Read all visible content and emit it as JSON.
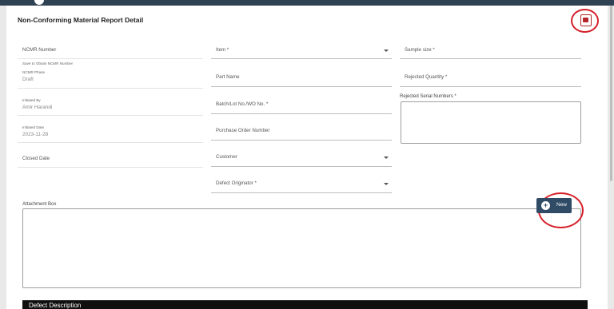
{
  "page": {
    "title": "Non-Conforming Material Report Detail"
  },
  "fields": {
    "ncmr_number": "NCMR Number",
    "ncmr_number_hint": "Save to Obtain NCMR Number",
    "ncmr_phase_label": "NCMR Phase",
    "ncmr_phase_value": "Draft",
    "initiated_by_label": "Initiated By",
    "initiated_by_value": "Amir Harandi",
    "initiated_date_label": "Initiated Date",
    "initiated_date_value": "2023-11-28",
    "closed_date": "Closed Date",
    "item": "Item *",
    "part_name": "Part Name",
    "batch_lot": "Batch/Lot No./WO No. *",
    "purchase_order": "Purchase Order Number",
    "customer": "Customer",
    "defect_originator": "Defect Originator *",
    "sample_size": "Sample size *",
    "rejected_quantity": "Rejected Quantity *",
    "rejected_serial_numbers": "Rejected Serial Numbers *"
  },
  "attachment": {
    "label": "Attachment Box",
    "new_button": "New"
  },
  "section": {
    "defect_description": "Defect Description"
  },
  "icons": {
    "pdf": "pdf-icon",
    "plus": "plus-circle-icon"
  },
  "colors": {
    "header": "#2f4253",
    "button": "#2f4b66",
    "highlight": "#d61f2a"
  }
}
